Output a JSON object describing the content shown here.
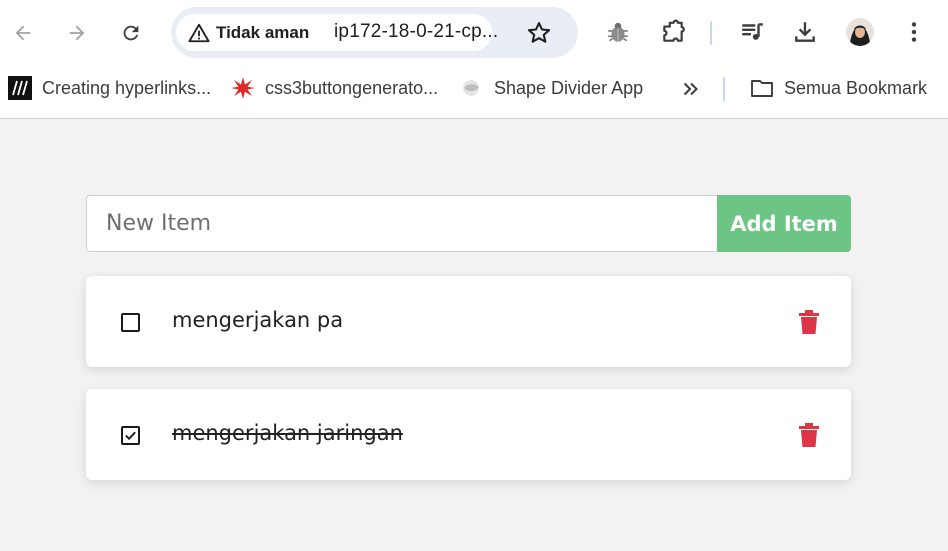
{
  "browser": {
    "security_chip": "Tidak aman",
    "url": "ip172-18-0-21-cp...",
    "bookmarks": [
      {
        "label": "Creating hyperlinks...",
        "icon": "mdn-icon"
      },
      {
        "label": "css3buttongenerato...",
        "icon": "star-burst-icon"
      },
      {
        "label": "Shape Divider App",
        "icon": "shape-divider-icon"
      }
    ],
    "all_bookmarks_label": "Semua Bookmark"
  },
  "app": {
    "input_placeholder": "New Item",
    "input_value": "",
    "add_button_label": "Add Item",
    "accent_color": "#6cc485",
    "delete_color": "#dc3545",
    "todos": [
      {
        "text": "mengerjakan pa",
        "completed": false
      },
      {
        "text": "mengerjakan jaringan",
        "completed": true
      }
    ]
  }
}
